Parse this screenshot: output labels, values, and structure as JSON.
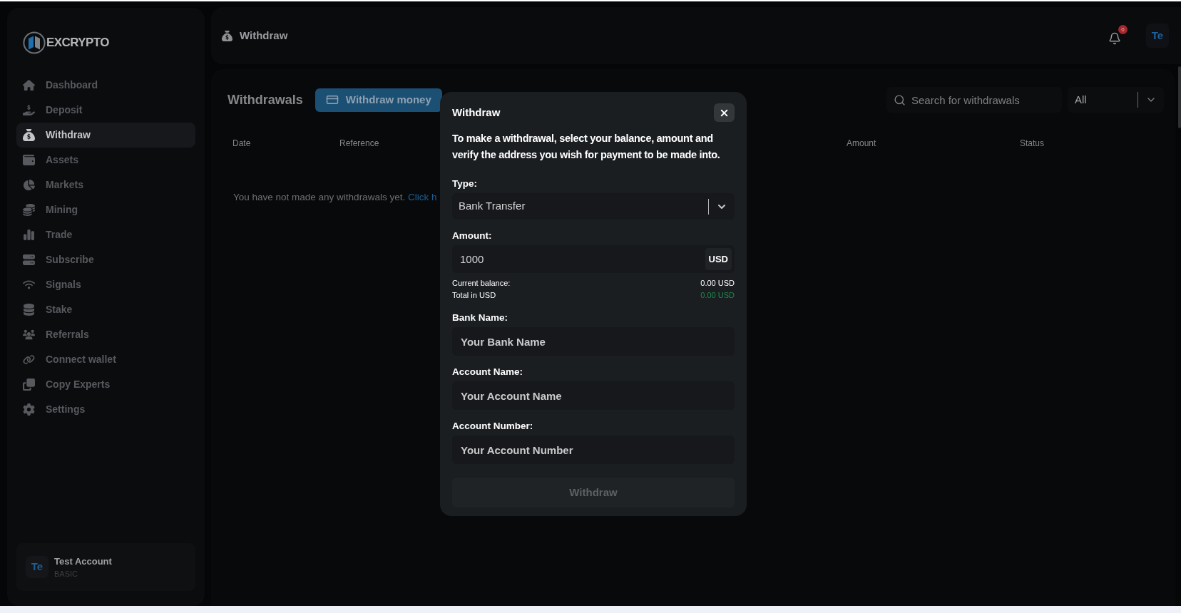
{
  "sidebar": {
    "logo": "EXCRYPTO",
    "items": [
      {
        "label": "Dashboard",
        "selected": false
      },
      {
        "label": "Deposit",
        "selected": false
      },
      {
        "label": "Withdraw",
        "selected": true
      },
      {
        "label": "Assets",
        "selected": false
      },
      {
        "label": "Markets",
        "selected": false
      },
      {
        "label": "Mining",
        "selected": false
      },
      {
        "label": "Trade",
        "selected": false
      },
      {
        "label": "Subscribe",
        "selected": false
      },
      {
        "label": "Signals",
        "selected": false
      },
      {
        "label": "Stake",
        "selected": false
      },
      {
        "label": "Referrals",
        "selected": false
      },
      {
        "label": "Connect wallet",
        "selected": false
      },
      {
        "label": "Copy Experts",
        "selected": false
      },
      {
        "label": "Settings",
        "selected": false
      }
    ],
    "user": {
      "initials": "Te",
      "name": "Test Account",
      "plan": "BASIC"
    }
  },
  "header": {
    "title": "Withdraw",
    "notification_count": "0",
    "initials": "Te"
  },
  "withdrawals": {
    "title": "Withdrawals",
    "action": "Withdraw money",
    "search": {
      "placeholder": "Search for withdrawals"
    },
    "filter": {
      "value": "All"
    },
    "columns": [
      "Date",
      "Reference",
      "Amount",
      "Status"
    ],
    "empty": {
      "text": "You have not made any withdrawals yet.",
      "link": "Click h"
    }
  },
  "modal": {
    "title": "Withdraw",
    "description": "To make a withdrawal, select your balance, amount and verify the address you wish for payment to be made into.",
    "type": {
      "label": "Type:",
      "value": "Bank Transfer"
    },
    "amount": {
      "label": "Amount:",
      "value": "1000",
      "unit": "USD"
    },
    "summary": [
      {
        "label": "Current balance:",
        "value": "0.00 USD",
        "color": "#ffffff"
      },
      {
        "label": "Total in USD",
        "value": "0.00 USD",
        "color": "#1e8a4c"
      }
    ],
    "fields": [
      {
        "label": "Bank Name:",
        "placeholder": "Your Bank Name"
      },
      {
        "label": "Account Name:",
        "placeholder": "Your Account Name"
      },
      {
        "label": "Account Number:",
        "placeholder": "Your Account Number"
      }
    ],
    "submit": {
      "label": "Withdraw",
      "disabled": true
    }
  }
}
